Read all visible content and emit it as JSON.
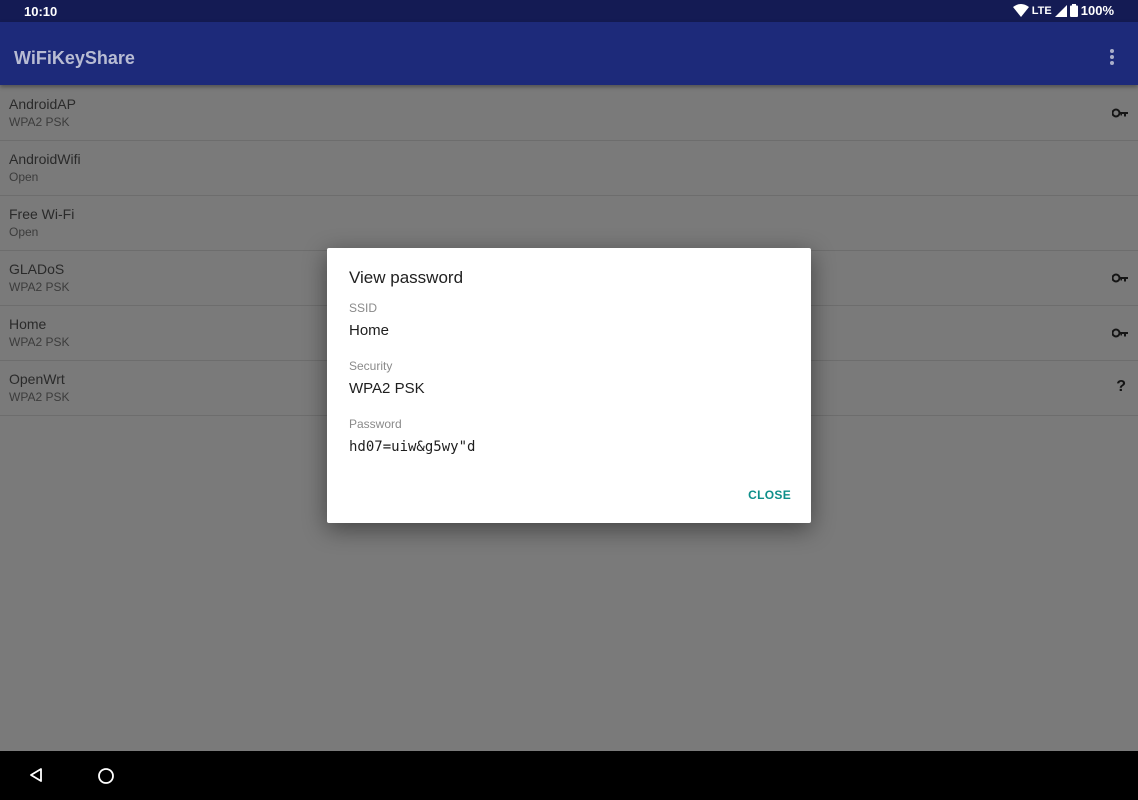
{
  "status_bar": {
    "time": "10:10",
    "network": "LTE",
    "battery": "100%"
  },
  "app_bar": {
    "title": "WiFiKeyShare",
    "overflow_icon": "more-vert-icon"
  },
  "networks": [
    {
      "ssid": "AndroidAP",
      "security": "WPA2 PSK",
      "icon": "key-icon"
    },
    {
      "ssid": "AndroidWifi",
      "security": "Open",
      "icon": ""
    },
    {
      "ssid": "Free Wi-Fi",
      "security": "Open",
      "icon": ""
    },
    {
      "ssid": "GLADoS",
      "security": "WPA2 PSK",
      "icon": "key-icon"
    },
    {
      "ssid": "Home",
      "security": "WPA2 PSK",
      "icon": "key-icon"
    },
    {
      "ssid": "OpenWrt",
      "security": "WPA2 PSK",
      "icon": "?"
    }
  ],
  "dialog": {
    "title": "View password",
    "ssid_label": "SSID",
    "ssid_value": "Home",
    "security_label": "Security",
    "security_value": "WPA2 PSK",
    "password_label": "Password",
    "password_value": "hd07=uiw&g5wy\"d",
    "close_label": "CLOSE"
  },
  "colors": {
    "status_bar": "#141b54",
    "app_bar": "#1d2a7a",
    "accent": "#0e8f8a",
    "scrim_background": "#7a7a7a"
  }
}
